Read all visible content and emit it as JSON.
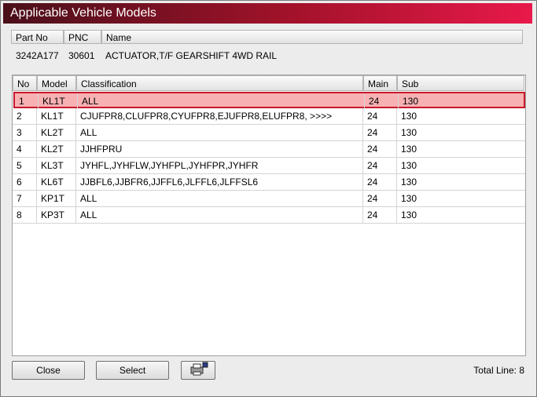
{
  "window": {
    "title": "Applicable Vehicle Models"
  },
  "part": {
    "headers": {
      "part_no": "Part No",
      "pnc": "PNC",
      "name": "Name"
    },
    "values": {
      "part_no": "3242A177",
      "pnc": "30601",
      "name": "ACTUATOR,T/F GEARSHIFT 4WD RAIL"
    }
  },
  "grid": {
    "headers": {
      "no": "No",
      "model": "Model",
      "classification": "Classification",
      "main": "Main",
      "sub": "Sub"
    },
    "rows": [
      {
        "no": "1",
        "model": "KL1T",
        "classification": "ALL",
        "main": "24",
        "sub": "130"
      },
      {
        "no": "2",
        "model": "KL1T",
        "classification": "CJUFPR8,CLUFPR8,CYUFPR8,EJUFPR8,ELUFPR8,  >>>>",
        "main": "24",
        "sub": "130"
      },
      {
        "no": "3",
        "model": "KL2T",
        "classification": "ALL",
        "main": "24",
        "sub": "130"
      },
      {
        "no": "4",
        "model": "KL2T",
        "classification": "JJHFPRU",
        "main": "24",
        "sub": "130"
      },
      {
        "no": "5",
        "model": "KL3T",
        "classification": "JYHFL,JYHFLW,JYHFPL,JYHFPR,JYHFR",
        "main": "24",
        "sub": "130"
      },
      {
        "no": "6",
        "model": "KL6T",
        "classification": "JJBFL6,JJBFR6,JJFFL6,JLFFL6,JLFFSL6",
        "main": "24",
        "sub": "130"
      },
      {
        "no": "7",
        "model": "KP1T",
        "classification": "ALL",
        "main": "24",
        "sub": "130"
      },
      {
        "no": "8",
        "model": "KP3T",
        "classification": "ALL",
        "main": "24",
        "sub": "130"
      }
    ]
  },
  "footer": {
    "close_label": "Close",
    "select_label": "Select",
    "print_icon": "printer-icon",
    "total_text": "Total Line: 8"
  },
  "colors": {
    "selected_bg": "#f7b1b3",
    "selected_border": "#c8182b",
    "title_start": "#4a0f1a",
    "title_end": "#e8194a"
  }
}
